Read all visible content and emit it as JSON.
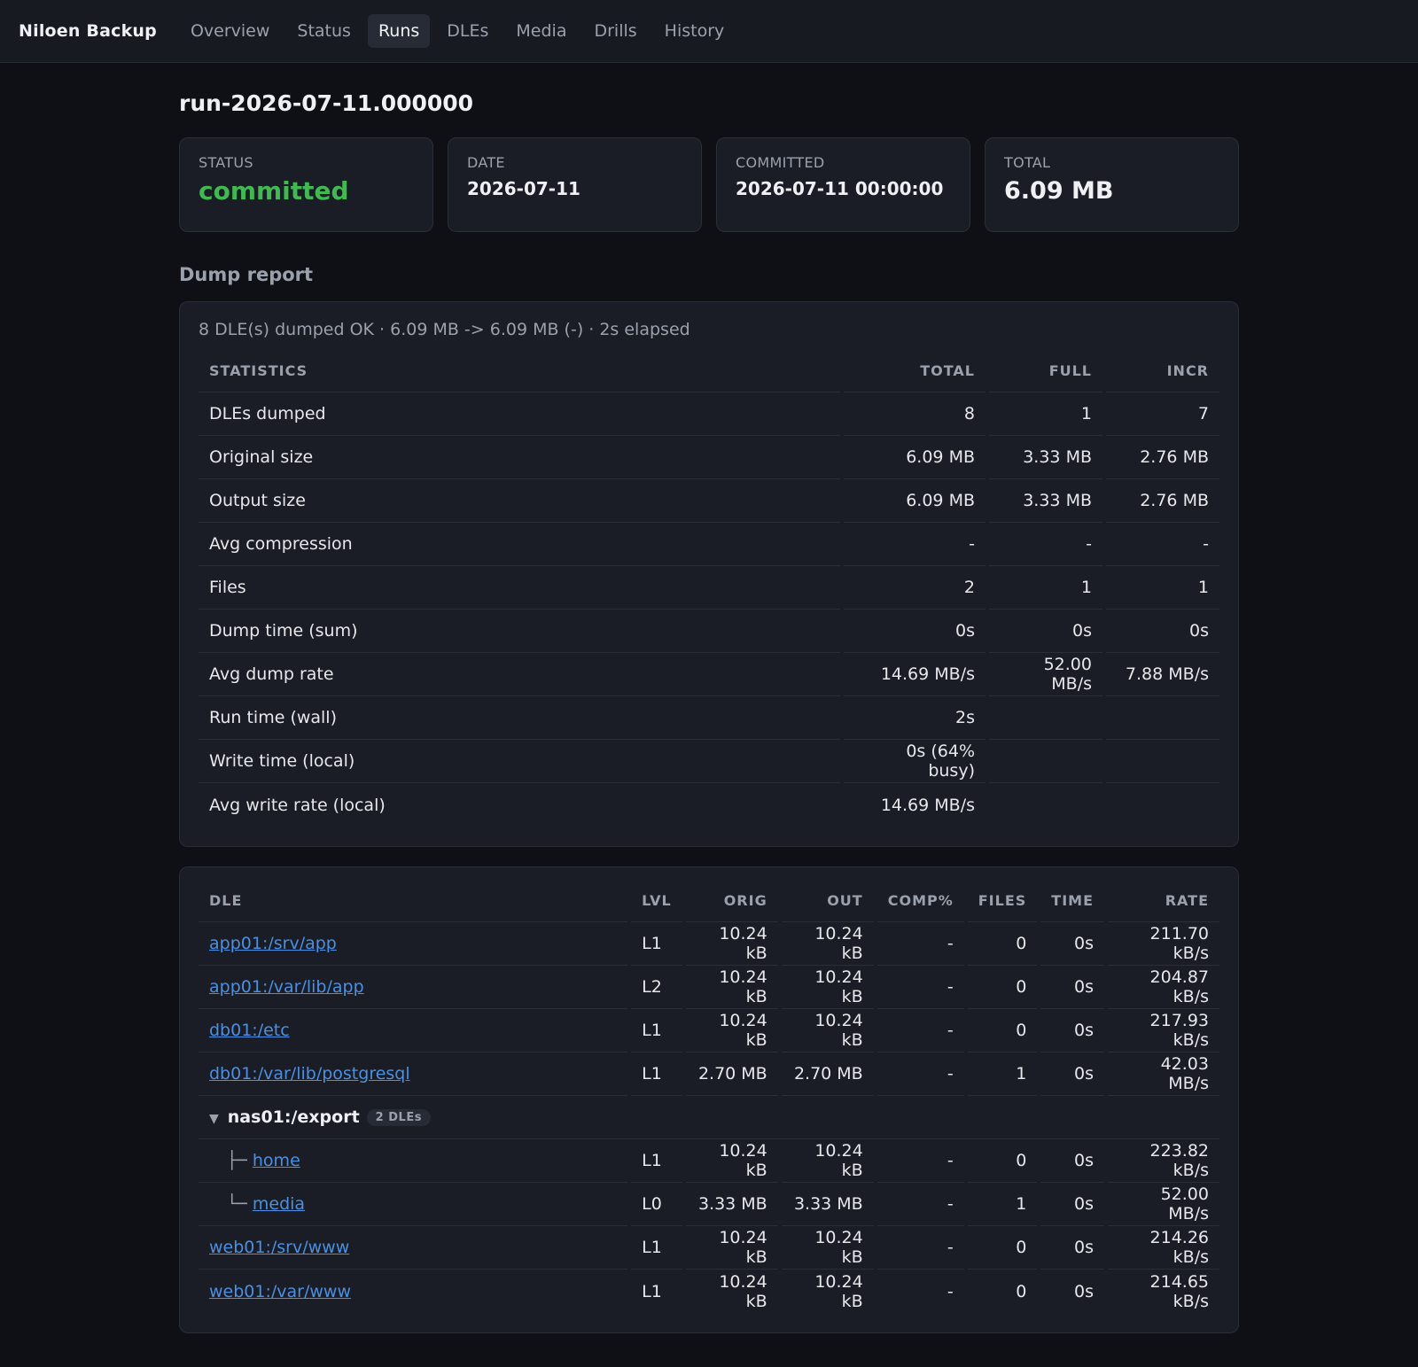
{
  "nav": {
    "brand": "Niloen Backup",
    "items": [
      {
        "label": "Overview",
        "active": false
      },
      {
        "label": "Status",
        "active": false
      },
      {
        "label": "Runs",
        "active": true
      },
      {
        "label": "DLEs",
        "active": false
      },
      {
        "label": "Media",
        "active": false
      },
      {
        "label": "Drills",
        "active": false
      },
      {
        "label": "History",
        "active": false
      }
    ]
  },
  "run": {
    "title": "run-2026-07-11.000000",
    "cards": {
      "status": {
        "label": "STATUS",
        "value": "committed"
      },
      "date": {
        "label": "DATE",
        "value": "2026-07-11"
      },
      "committed": {
        "label": "COMMITTED",
        "value": "2026-07-11 00:00:00"
      },
      "total": {
        "label": "TOTAL",
        "value": "6.09 MB"
      }
    }
  },
  "dump_report": {
    "title": "Dump report",
    "summary": "8 DLE(s) dumped OK · 6.09 MB -> 6.09 MB (-) · 2s elapsed",
    "headers": [
      "STATISTICS",
      "TOTAL",
      "FULL",
      "INCR"
    ],
    "rows": [
      [
        "DLEs dumped",
        "8",
        "1",
        "7"
      ],
      [
        "Original size",
        "6.09 MB",
        "3.33 MB",
        "2.76 MB"
      ],
      [
        "Output size",
        "6.09 MB",
        "3.33 MB",
        "2.76 MB"
      ],
      [
        "Avg compression",
        "-",
        "-",
        "-"
      ],
      [
        "Files",
        "2",
        "1",
        "1"
      ],
      [
        "Dump time (sum)",
        "0s",
        "0s",
        "0s"
      ],
      [
        "Avg dump rate",
        "14.69 MB/s",
        "52.00 MB/s",
        "7.88 MB/s"
      ],
      [
        "Run time (wall)",
        "2s",
        "",
        ""
      ],
      [
        "Write time (local)",
        "0s (64% busy)",
        "",
        ""
      ],
      [
        "Avg write rate (local)",
        "14.69 MB/s",
        "",
        ""
      ]
    ]
  },
  "dle_table": {
    "headers": [
      "DLE",
      "LVL",
      "ORIG",
      "OUT",
      "COMP%",
      "FILES",
      "TIME",
      "RATE"
    ],
    "rows": [
      {
        "type": "dle",
        "name": "app01:/srv/app",
        "cells": [
          "L1",
          "10.24 kB",
          "10.24 kB",
          "-",
          "0",
          "0s",
          "211.70 kB/s"
        ]
      },
      {
        "type": "dle",
        "name": "app01:/var/lib/app",
        "cells": [
          "L2",
          "10.24 kB",
          "10.24 kB",
          "-",
          "0",
          "0s",
          "204.87 kB/s"
        ]
      },
      {
        "type": "dle",
        "name": "db01:/etc",
        "cells": [
          "L1",
          "10.24 kB",
          "10.24 kB",
          "-",
          "0",
          "0s",
          "217.93 kB/s"
        ]
      },
      {
        "type": "dle",
        "name": "db01:/var/lib/postgresql",
        "cells": [
          "L1",
          "2.70 MB",
          "2.70 MB",
          "-",
          "1",
          "0s",
          "42.03 MB/s"
        ]
      },
      {
        "type": "group",
        "caret": "▼",
        "name": "nas01:/export",
        "badge": "2 DLEs"
      },
      {
        "type": "child",
        "tree": "├─",
        "name": "home",
        "cells": [
          "L1",
          "10.24 kB",
          "10.24 kB",
          "-",
          "0",
          "0s",
          "223.82 kB/s"
        ]
      },
      {
        "type": "child",
        "tree": "└─",
        "name": "media",
        "cells": [
          "L0",
          "3.33 MB",
          "3.33 MB",
          "-",
          "1",
          "0s",
          "52.00 MB/s"
        ]
      },
      {
        "type": "dle",
        "name": "web01:/srv/www",
        "cells": [
          "L1",
          "10.24 kB",
          "10.24 kB",
          "-",
          "0",
          "0s",
          "214.26 kB/s"
        ]
      },
      {
        "type": "dle",
        "name": "web01:/var/www",
        "cells": [
          "L1",
          "10.24 kB",
          "10.24 kB",
          "-",
          "0",
          "0s",
          "214.65 kB/s"
        ]
      }
    ]
  },
  "colors": {
    "status_ok": "#3fb950",
    "link": "#4a90e2",
    "background": "#0e1015",
    "panel": "#1a1d25"
  }
}
